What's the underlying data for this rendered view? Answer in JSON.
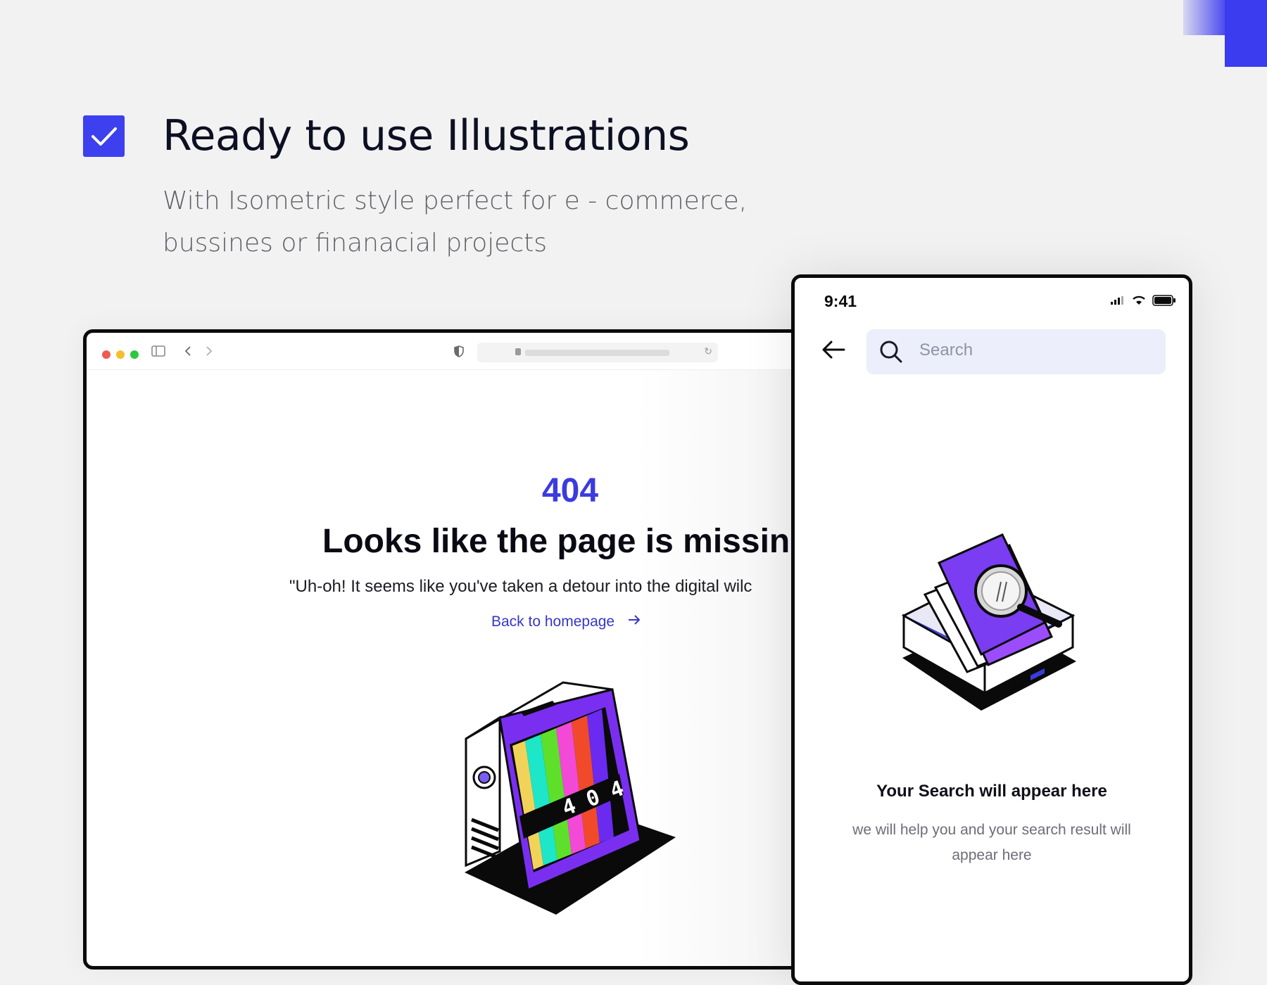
{
  "hero": {
    "title": "Ready to use Illustrations",
    "subtitle_line1": "With Isometric style perfect for e - commerce,",
    "subtitle_line2": "bussines or finanacial projects"
  },
  "browser": {
    "error_code": "404",
    "error_title": "Looks like the page is missin",
    "error_description": "\"Uh-oh! It seems like you've taken a detour into the digital wilc",
    "back_link": "Back to homepage",
    "tv_label": "4 0 4"
  },
  "phone": {
    "time": "9:41",
    "search_placeholder": "Search",
    "result_title": "Your Search will appear here",
    "result_description": "we will help you and your search result will appear here"
  },
  "colors": {
    "accent": "#3c40ee",
    "link": "#3636c8",
    "search_bg": "#eceefb"
  }
}
